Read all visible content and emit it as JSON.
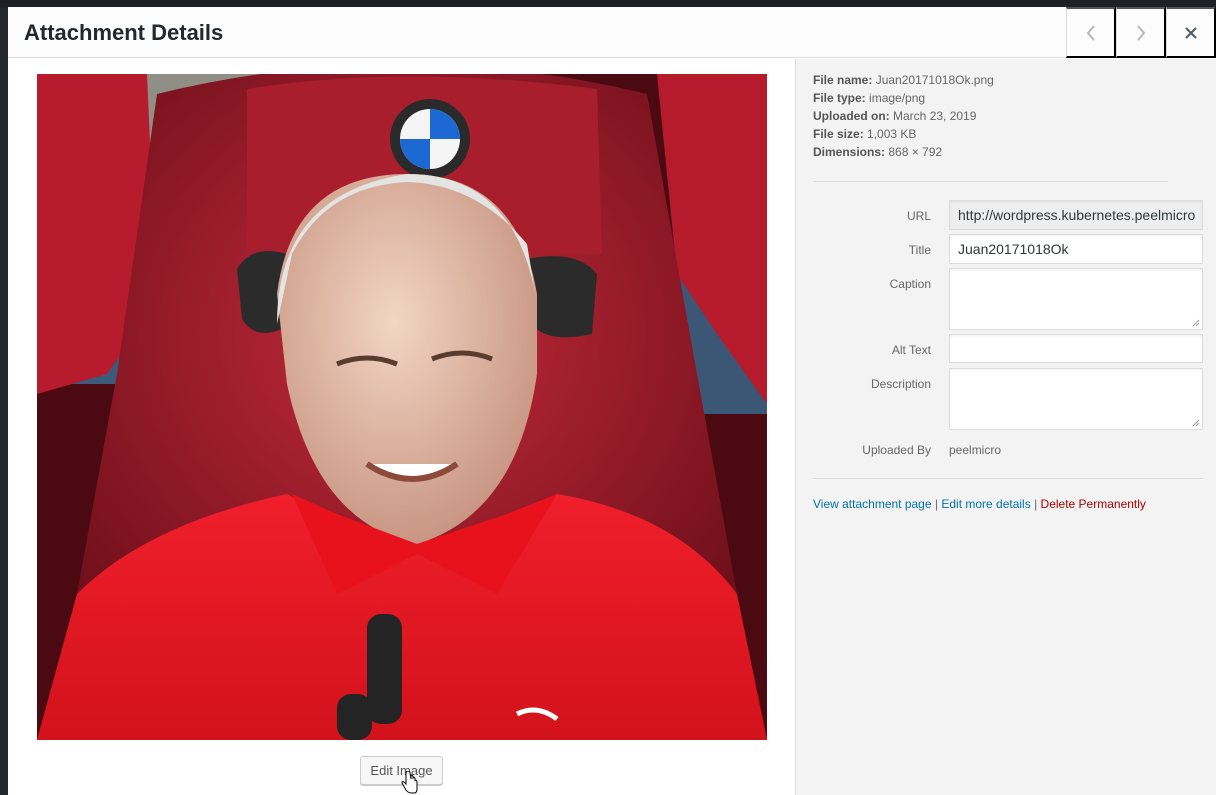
{
  "header": {
    "title": "Attachment Details",
    "prev_icon": "chevron-left-icon",
    "next_icon": "chevron-right-icon",
    "close_icon": "close-icon"
  },
  "preview": {
    "edit_button_label": "Edit Image"
  },
  "file_info": {
    "file_name_label": "File name:",
    "file_name": "Juan20171018Ok.png",
    "file_type_label": "File type:",
    "file_type": "image/png",
    "uploaded_on_label": "Uploaded on:",
    "uploaded_on": "March 23, 2019",
    "file_size_label": "File size:",
    "file_size": "1,003 KB",
    "dimensions_label": "Dimensions:",
    "dimensions": "868 × 792"
  },
  "fields": {
    "url_label": "URL",
    "url_value": "http://wordpress.kubernetes.peelmicro",
    "title_label": "Title",
    "title_value": "Juan20171018Ok",
    "caption_label": "Caption",
    "caption_value": "",
    "alt_text_label": "Alt Text",
    "alt_text_value": "",
    "description_label": "Description",
    "description_value": "",
    "uploaded_by_label": "Uploaded By",
    "uploaded_by_value": "peelmicro"
  },
  "actions": {
    "view_attachment": "View attachment page",
    "separator": "|",
    "edit_more": "Edit more details",
    "delete": "Delete Permanently"
  },
  "colors": {
    "link": "#0073aa",
    "delete": "#aa0000",
    "sidebar_bg": "#f3f3f3"
  }
}
